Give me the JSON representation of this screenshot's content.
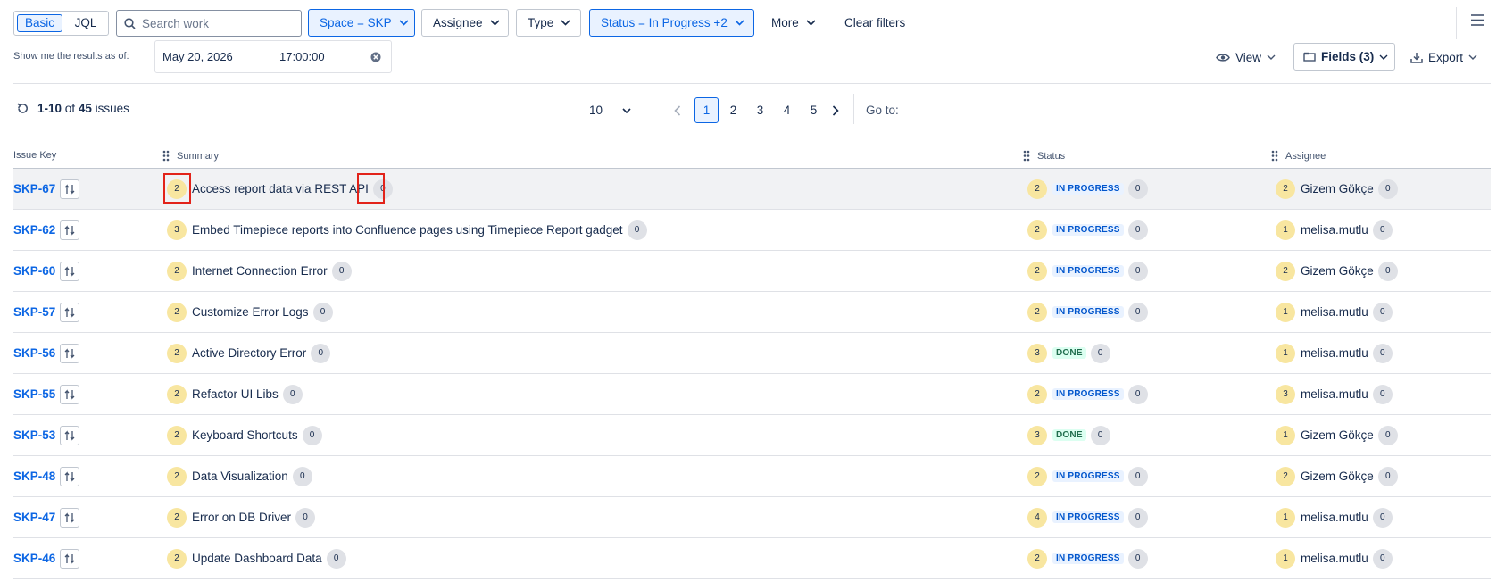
{
  "toolbar": {
    "mode_basic": "Basic",
    "mode_jql": "JQL",
    "search_placeholder": "Search work",
    "filters": {
      "space": "Space = SKP",
      "assignee": "Assignee",
      "type": "Type",
      "status": "Status = In Progress +2",
      "more": "More",
      "clear": "Clear filters"
    }
  },
  "as_of": {
    "label": "Show me the results as of:",
    "date": "May 20, 2026",
    "time": "17:00:00"
  },
  "view_controls": {
    "view": "View",
    "fields": "Fields (3)",
    "export": "Export"
  },
  "results": {
    "range": "1-10",
    "of": "of",
    "total": "45",
    "unit": "issues"
  },
  "pagination": {
    "page_size": "10",
    "pages": [
      "1",
      "2",
      "3",
      "4",
      "5"
    ],
    "current": "1",
    "goto_label": "Go to:"
  },
  "columns": {
    "key": "Issue Key",
    "summary": "Summary",
    "status": "Status",
    "assignee": "Assignee"
  },
  "rows": [
    {
      "key": "SKP-67",
      "summary_count": "2",
      "summary": "Access report data via REST API",
      "summary_end": "0",
      "status_count": "2",
      "status": "IN PROGRESS",
      "status_end": "0",
      "assignee_count": "2",
      "assignee": "Gizem Gökçe",
      "assignee_end": "0"
    },
    {
      "key": "SKP-62",
      "summary_count": "3",
      "summary": "Embed Timepiece reports into Confluence pages using Timepiece Report gadget",
      "summary_end": "0",
      "status_count": "2",
      "status": "IN PROGRESS",
      "status_end": "0",
      "assignee_count": "1",
      "assignee": "melisa.mutlu",
      "assignee_end": "0"
    },
    {
      "key": "SKP-60",
      "summary_count": "2",
      "summary": "Internet Connection Error",
      "summary_end": "0",
      "status_count": "2",
      "status": "IN PROGRESS",
      "status_end": "0",
      "assignee_count": "2",
      "assignee": "Gizem Gökçe",
      "assignee_end": "0"
    },
    {
      "key": "SKP-57",
      "summary_count": "2",
      "summary": "Customize Error Logs",
      "summary_end": "0",
      "status_count": "2",
      "status": "IN PROGRESS",
      "status_end": "0",
      "assignee_count": "1",
      "assignee": "melisa.mutlu",
      "assignee_end": "0"
    },
    {
      "key": "SKP-56",
      "summary_count": "2",
      "summary": "Active Directory Error",
      "summary_end": "0",
      "status_count": "3",
      "status": "DONE",
      "status_end": "0",
      "assignee_count": "1",
      "assignee": "melisa.mutlu",
      "assignee_end": "0"
    },
    {
      "key": "SKP-55",
      "summary_count": "2",
      "summary": "Refactor UI Libs",
      "summary_end": "0",
      "status_count": "2",
      "status": "IN PROGRESS",
      "status_end": "0",
      "assignee_count": "3",
      "assignee": "melisa.mutlu",
      "assignee_end": "0"
    },
    {
      "key": "SKP-53",
      "summary_count": "2",
      "summary": "Keyboard Shortcuts",
      "summary_end": "0",
      "status_count": "3",
      "status": "DONE",
      "status_end": "0",
      "assignee_count": "1",
      "assignee": "Gizem Gökçe",
      "assignee_end": "0"
    },
    {
      "key": "SKP-48",
      "summary_count": "2",
      "summary": "Data Visualization",
      "summary_end": "0",
      "status_count": "2",
      "status": "IN PROGRESS",
      "status_end": "0",
      "assignee_count": "2",
      "assignee": "Gizem Gökçe",
      "assignee_end": "0"
    },
    {
      "key": "SKP-47",
      "summary_count": "2",
      "summary": "Error on DB Driver",
      "summary_end": "0",
      "status_count": "4",
      "status": "IN PROGRESS",
      "status_end": "0",
      "assignee_count": "1",
      "assignee": "melisa.mutlu",
      "assignee_end": "0"
    },
    {
      "key": "SKP-46",
      "summary_count": "2",
      "summary": "Update Dashboard Data",
      "summary_end": "0",
      "status_count": "2",
      "status": "IN PROGRESS",
      "status_end": "0",
      "assignee_count": "1",
      "assignee": "melisa.mutlu",
      "assignee_end": "0"
    }
  ]
}
